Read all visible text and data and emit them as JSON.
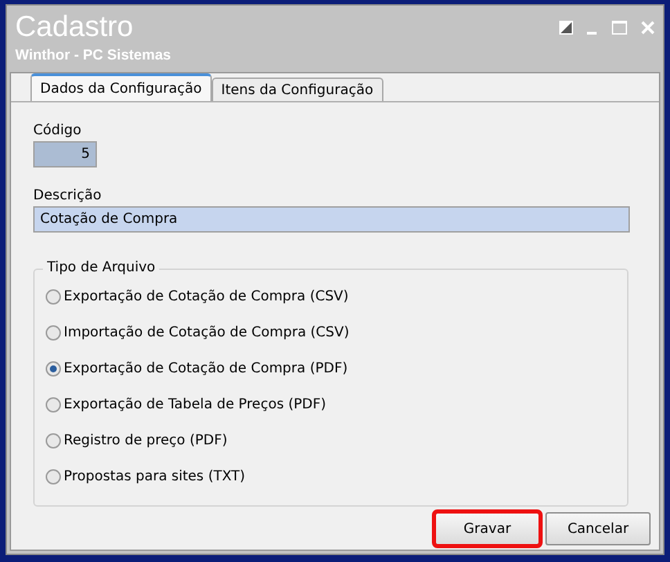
{
  "window": {
    "title": "Cadastro",
    "subtitle": "Winthor - PC Sistemas"
  },
  "tabs": [
    {
      "label": "Dados da Configuração",
      "selected": true
    },
    {
      "label": "Itens da Configuração",
      "selected": false
    }
  ],
  "codigo": {
    "label": "Código",
    "value": "5"
  },
  "descricao": {
    "label": "Descrição",
    "value": "Cotação de Compra"
  },
  "tipo_de_arquivo": {
    "legend": "Tipo de Arquivo",
    "options": [
      {
        "label": "Exportação de Cotação de Compra (CSV)",
        "selected": false
      },
      {
        "label": "Importação de Cotação de Compra (CSV)",
        "selected": false
      },
      {
        "label": "Exportação de Cotação de Compra (PDF)",
        "selected": true
      },
      {
        "label": "Exportação de Tabela de Preços (PDF)",
        "selected": false
      },
      {
        "label": "Registro de preço (PDF)",
        "selected": false
      },
      {
        "label": "Propostas para sites (TXT)",
        "selected": false
      }
    ]
  },
  "buttons": [
    {
      "label": "Gravar",
      "highlighted": true
    },
    {
      "label": "Cancelar",
      "highlighted": false
    }
  ]
}
